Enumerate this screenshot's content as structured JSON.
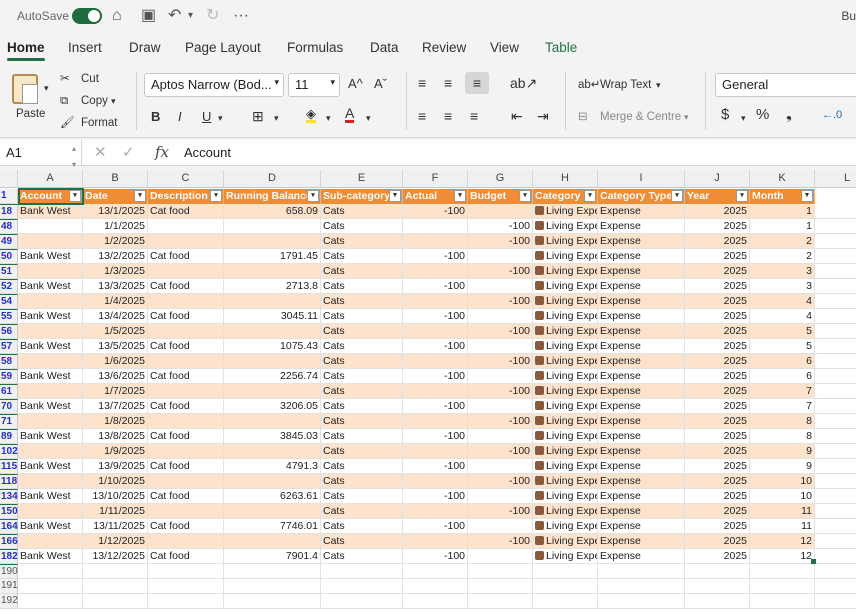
{
  "titlebar": {
    "autosave_label": "AutoSave",
    "title_fragment": "Bu"
  },
  "tabs": [
    "Home",
    "Insert",
    "Draw",
    "Page Layout",
    "Formulas",
    "Data",
    "Review",
    "View",
    "Table"
  ],
  "ribbon": {
    "paste": "Paste",
    "cut": "Cut",
    "copy": "Copy",
    "format": "Format",
    "font_name": "Aptos Narrow (Bod...",
    "font_size": "11",
    "bold": "B",
    "italic": "I",
    "underline": "U",
    "wrap_text": "Wrap Text",
    "merge_centre": "Merge & Centre",
    "number_format": "General"
  },
  "formula_bar": {
    "name_box": "A1",
    "fx": "fx",
    "formula": "Account"
  },
  "columns": [
    "A",
    "B",
    "C",
    "D",
    "E",
    "F",
    "G",
    "H",
    "I",
    "J",
    "K",
    "L"
  ],
  "headers": [
    "Account",
    "Date",
    "Description",
    "Running Balance",
    "Sub-category",
    "Actual",
    "Budget",
    "Category",
    "Category Type",
    "Year",
    "Month"
  ],
  "rows": [
    {
      "n": "1",
      "cells": [
        "",
        "",
        "",
        "",
        "",
        "",
        "",
        "",
        "",
        "",
        ""
      ],
      "header": true
    },
    {
      "n": "18",
      "cells": [
        "Bank West",
        "13/1/2025",
        "Cat food",
        "658.09",
        "Cats",
        "-100",
        "",
        "Living Expe",
        "Expense",
        "2025",
        "1"
      ]
    },
    {
      "n": "48",
      "cells": [
        "",
        "1/1/2025",
        "",
        "",
        "Cats",
        "",
        "-100",
        "Living Expe",
        "Expense",
        "2025",
        "1"
      ]
    },
    {
      "n": "49",
      "cells": [
        "",
        "1/2/2025",
        "",
        "",
        "Cats",
        "",
        "-100",
        "Living Expe",
        "Expense",
        "2025",
        "2"
      ]
    },
    {
      "n": "50",
      "cells": [
        "Bank West",
        "13/2/2025",
        "Cat food",
        "1791.45",
        "Cats",
        "-100",
        "",
        "Living Expe",
        "Expense",
        "2025",
        "2"
      ]
    },
    {
      "n": "51",
      "cells": [
        "",
        "1/3/2025",
        "",
        "",
        "Cats",
        "",
        "-100",
        "Living Expe",
        "Expense",
        "2025",
        "3"
      ]
    },
    {
      "n": "52",
      "cells": [
        "Bank West",
        "13/3/2025",
        "Cat food",
        "2713.8",
        "Cats",
        "-100",
        "",
        "Living Expe",
        "Expense",
        "2025",
        "3"
      ]
    },
    {
      "n": "54",
      "cells": [
        "",
        "1/4/2025",
        "",
        "",
        "Cats",
        "",
        "-100",
        "Living Expe",
        "Expense",
        "2025",
        "4"
      ]
    },
    {
      "n": "55",
      "cells": [
        "Bank West",
        "13/4/2025",
        "Cat food",
        "3045.11",
        "Cats",
        "-100",
        "",
        "Living Expe",
        "Expense",
        "2025",
        "4"
      ]
    },
    {
      "n": "56",
      "cells": [
        "",
        "1/5/2025",
        "",
        "",
        "Cats",
        "",
        "-100",
        "Living Expe",
        "Expense",
        "2025",
        "5"
      ]
    },
    {
      "n": "57",
      "cells": [
        "Bank West",
        "13/5/2025",
        "Cat food",
        "1075.43",
        "Cats",
        "-100",
        "",
        "Living Expe",
        "Expense",
        "2025",
        "5"
      ]
    },
    {
      "n": "58",
      "cells": [
        "",
        "1/6/2025",
        "",
        "",
        "Cats",
        "",
        "-100",
        "Living Expe",
        "Expense",
        "2025",
        "6"
      ]
    },
    {
      "n": "59",
      "cells": [
        "Bank West",
        "13/6/2025",
        "Cat food",
        "2256.74",
        "Cats",
        "-100",
        "",
        "Living Expe",
        "Expense",
        "2025",
        "6"
      ]
    },
    {
      "n": "61",
      "cells": [
        "",
        "1/7/2025",
        "",
        "",
        "Cats",
        "",
        "-100",
        "Living Expe",
        "Expense",
        "2025",
        "7"
      ]
    },
    {
      "n": "70",
      "cells": [
        "Bank West",
        "13/7/2025",
        "Cat food",
        "3206.05",
        "Cats",
        "-100",
        "",
        "Living Expe",
        "Expense",
        "2025",
        "7"
      ]
    },
    {
      "n": "71",
      "cells": [
        "",
        "1/8/2025",
        "",
        "",
        "Cats",
        "",
        "-100",
        "Living Expe",
        "Expense",
        "2025",
        "8"
      ]
    },
    {
      "n": "89",
      "cells": [
        "Bank West",
        "13/8/2025",
        "Cat food",
        "3845.03",
        "Cats",
        "-100",
        "",
        "Living Expe",
        "Expense",
        "2025",
        "8"
      ]
    },
    {
      "n": "102",
      "cells": [
        "",
        "1/9/2025",
        "",
        "",
        "Cats",
        "",
        "-100",
        "Living Expe",
        "Expense",
        "2025",
        "9"
      ]
    },
    {
      "n": "115",
      "cells": [
        "Bank West",
        "13/9/2025",
        "Cat food",
        "4791.3",
        "Cats",
        "-100",
        "",
        "Living Expe",
        "Expense",
        "2025",
        "9"
      ]
    },
    {
      "n": "118",
      "cells": [
        "",
        "1/10/2025",
        "",
        "",
        "Cats",
        "",
        "-100",
        "Living Expe",
        "Expense",
        "2025",
        "10"
      ]
    },
    {
      "n": "134",
      "cells": [
        "Bank West",
        "13/10/2025",
        "Cat food",
        "6263.61",
        "Cats",
        "-100",
        "",
        "Living Expe",
        "Expense",
        "2025",
        "10"
      ]
    },
    {
      "n": "150",
      "cells": [
        "",
        "1/11/2025",
        "",
        "",
        "Cats",
        "",
        "-100",
        "Living Expe",
        "Expense",
        "2025",
        "11"
      ]
    },
    {
      "n": "164",
      "cells": [
        "Bank West",
        "13/11/2025",
        "Cat food",
        "7746.01",
        "Cats",
        "-100",
        "",
        "Living Expe",
        "Expense",
        "2025",
        "11"
      ]
    },
    {
      "n": "166",
      "cells": [
        "",
        "1/12/2025",
        "",
        "",
        "Cats",
        "",
        "-100",
        "Living Expe",
        "Expense",
        "2025",
        "12"
      ]
    },
    {
      "n": "182",
      "cells": [
        "Bank West",
        "13/12/2025",
        "Cat food",
        "7901.4",
        "Cats",
        "-100",
        "",
        "Living Expe",
        "Expense",
        "2025",
        "12"
      ]
    }
  ],
  "empty_rows": [
    "190",
    "191",
    "192"
  ],
  "colors": {
    "header_orange": "#f08c35",
    "band_light": "#fde3cc",
    "accent_green": "#1e7145",
    "filtered_rownum": "#2130c8"
  }
}
